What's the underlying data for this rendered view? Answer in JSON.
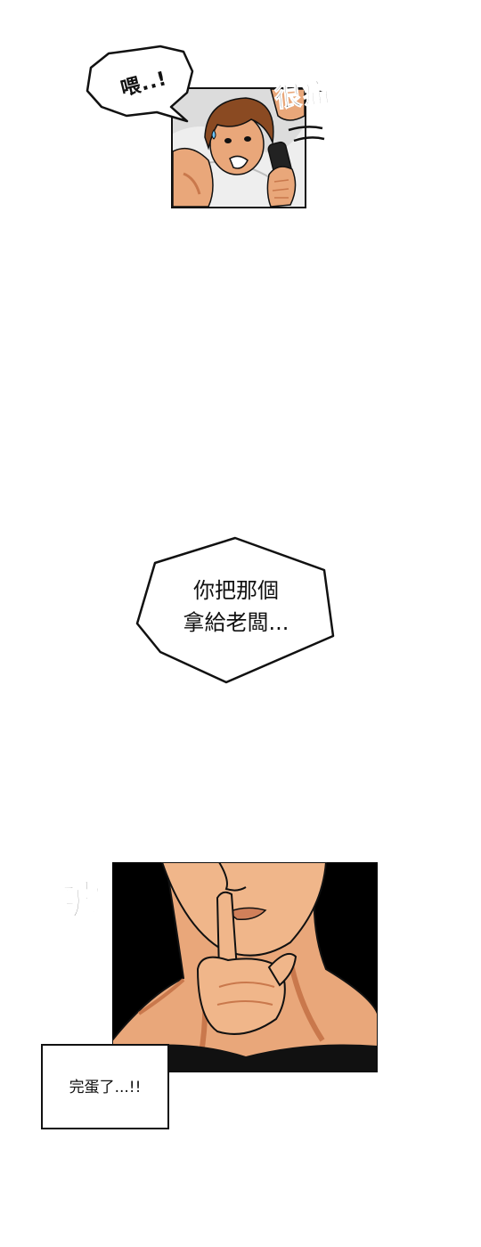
{
  "page": {
    "background": "#ffffff"
  },
  "panel_1": {
    "bubble_text": "喂..!",
    "sfx_text": "很痛"
  },
  "bubble_2": {
    "line_1": "你把那個",
    "line_2": "拿給老闆..."
  },
  "panel_2": {
    "sfx_text": "噓",
    "caption_text": "完蛋了...!!"
  },
  "colors": {
    "ink": "#111111",
    "skin": "#e9a77a",
    "skin_shadow": "#c9784c",
    "hair": "#8a4a22",
    "panel_dark": "#000000"
  }
}
